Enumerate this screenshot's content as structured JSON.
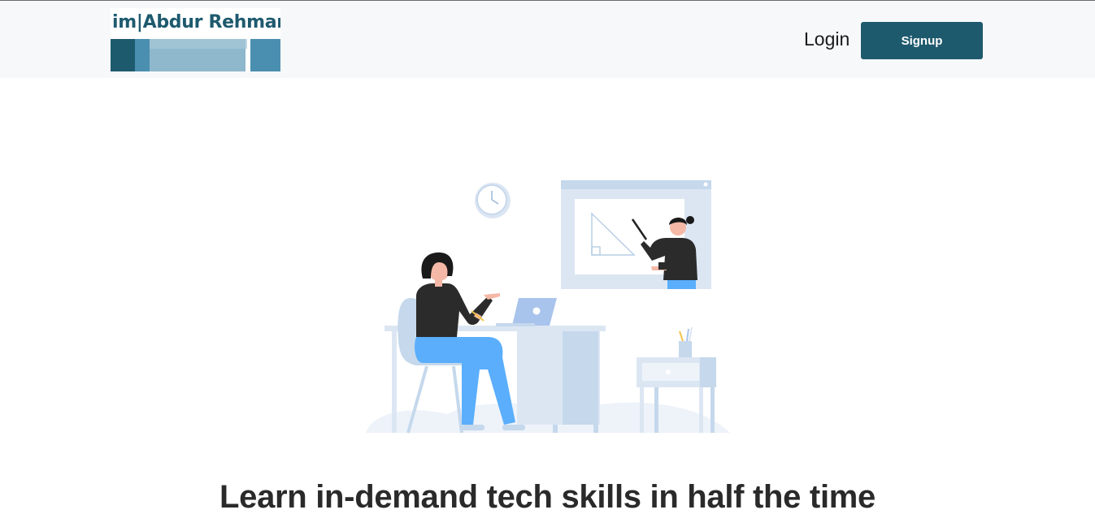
{
  "header": {
    "logo_text": "im|Abdur Rehman",
    "login_label": "Login",
    "signup_label": "Signup"
  },
  "hero": {
    "illustration": "online-learning-illustration",
    "headline": "Learn in-demand tech skills in half the time"
  },
  "colors": {
    "brand": "#1e5a6e",
    "header_bg": "#f7f8fa",
    "accent_blue": "#5aaefc",
    "illustration_light": "#dce6f3"
  }
}
